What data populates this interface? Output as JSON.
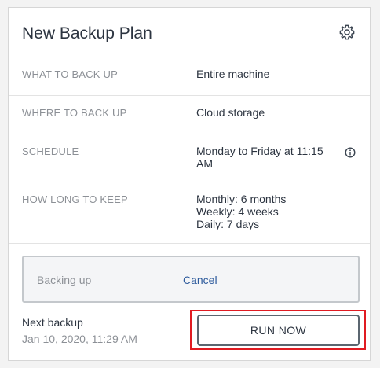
{
  "panel": {
    "title": "New Backup Plan",
    "settings_icon": "gear-icon"
  },
  "details": [
    {
      "label": "WHAT TO BACK UP",
      "value_lines": [
        "Entire machine"
      ]
    },
    {
      "label": "WHERE TO BACK UP",
      "value_lines": [
        "Cloud storage"
      ]
    },
    {
      "label": "SCHEDULE",
      "value_lines": [
        "Monday to Friday at 11:15",
        "AM"
      ],
      "icon": "info-icon"
    },
    {
      "label": "HOW LONG TO KEEP",
      "value_lines": [
        "Monthly: 6 months",
        "Weekly: 4 weeks",
        "Daily: 7 days"
      ]
    }
  ],
  "status": {
    "text": "Backing up",
    "cancel_label": "Cancel"
  },
  "next_backup": {
    "label": "Next backup",
    "time": "Jan 10, 2020, 11:29 AM"
  },
  "actions": {
    "run_now_label": "RUN NOW"
  },
  "colors": {
    "text_primary": "#2c3440",
    "text_muted": "#8c9096",
    "link": "#2d5a9c",
    "highlight": "#e01b22"
  }
}
